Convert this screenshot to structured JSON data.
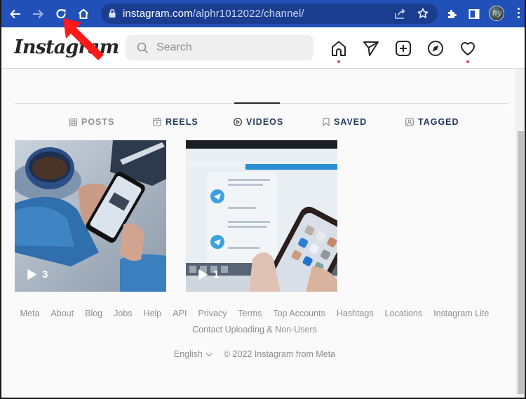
{
  "browser": {
    "url_host": "instagram.com",
    "url_path": "/alphr1012022/channel/",
    "nav_buttons": [
      "back-icon",
      "forward-icon",
      "reload-icon",
      "home-icon"
    ],
    "omnibox_icons": [
      "lock-icon",
      "share-icon",
      "star-icon"
    ],
    "toolbar_icons": [
      "extensions-icon",
      "side-panel-icon",
      "profile-avatar",
      "menu-icon"
    ],
    "accent_color": "#2150b8"
  },
  "header": {
    "logo": "Instagram",
    "search_placeholder": "Search",
    "nav_icons": [
      "home-icon",
      "direct-messages-icon",
      "new-post-icon",
      "explore-icon",
      "activity-icon"
    ],
    "notification_dot_color": "#ed4956"
  },
  "profile_tabs": [
    {
      "label": "POSTS",
      "icon": "grid-icon",
      "active": false
    },
    {
      "label": "REELS",
      "icon": "reels-icon",
      "active": false
    },
    {
      "label": "VIDEOS",
      "icon": "play-circle-icon",
      "active": true
    },
    {
      "label": "SAVED",
      "icon": "bookmark-icon",
      "active": false
    },
    {
      "label": "TAGGED",
      "icon": "tagged-icon",
      "active": false
    }
  ],
  "videos": [
    {
      "views": "3",
      "description": "hands holding a phone next to a blue coffee cup"
    },
    {
      "views": "1",
      "description": "hand holding a phone in front of a laptop showing Telegram"
    }
  ],
  "footer": {
    "links_row1": [
      "Meta",
      "About",
      "Blog",
      "Jobs",
      "Help",
      "API",
      "Privacy",
      "Terms",
      "Top Accounts",
      "Hashtags",
      "Locations",
      "Instagram Lite"
    ],
    "links_row2": [
      "Contact Uploading & Non-Users"
    ],
    "language": "English",
    "copyright": "© 2022 Instagram from Meta"
  },
  "annotation": {
    "type": "red-arrow",
    "points_to": "reload-icon",
    "color": "#ff0000"
  }
}
